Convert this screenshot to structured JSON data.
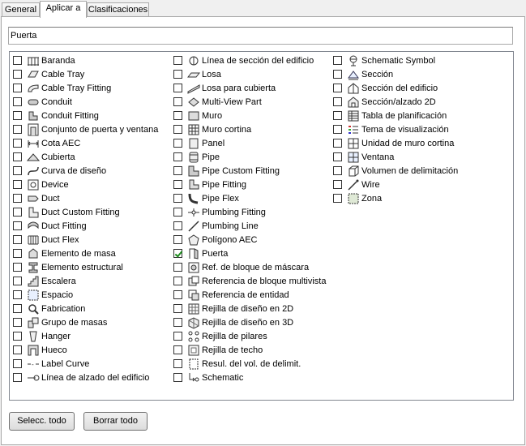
{
  "tabs": [
    {
      "label": "General"
    },
    {
      "label": "Aplicar a"
    },
    {
      "label": "Clasificaciones"
    }
  ],
  "name_field": {
    "value": "Puerta"
  },
  "columns": [
    [
      {
        "label": "Baranda",
        "icon": "railing-icon",
        "checked": false
      },
      {
        "label": "Cable Tray",
        "icon": "cable-tray-icon",
        "checked": false
      },
      {
        "label": "Cable Tray Fitting",
        "icon": "cable-tray-fitting-icon",
        "checked": false
      },
      {
        "label": "Conduit",
        "icon": "conduit-icon",
        "checked": false
      },
      {
        "label": "Conduit Fitting",
        "icon": "conduit-fitting-icon",
        "checked": false
      },
      {
        "label": "Conjunto de puerta y ventana",
        "icon": "door-window-assembly-icon",
        "checked": false
      },
      {
        "label": "Cota AEC",
        "icon": "dimension-icon",
        "checked": false
      },
      {
        "label": "Cubierta",
        "icon": "roof-icon",
        "checked": false
      },
      {
        "label": "Curva de diseño",
        "icon": "layout-curve-icon",
        "checked": false
      },
      {
        "label": "Device",
        "icon": "device-icon",
        "checked": false
      },
      {
        "label": "Duct",
        "icon": "duct-icon",
        "checked": false
      },
      {
        "label": "Duct Custom Fitting",
        "icon": "duct-custom-fitting-icon",
        "checked": false
      },
      {
        "label": "Duct Fitting",
        "icon": "duct-fitting-icon",
        "checked": false
      },
      {
        "label": "Duct Flex",
        "icon": "duct-flex-icon",
        "checked": false
      },
      {
        "label": "Elemento de masa",
        "icon": "mass-element-icon",
        "checked": false
      },
      {
        "label": "Elemento estructural",
        "icon": "structural-member-icon",
        "checked": false
      },
      {
        "label": "Escalera",
        "icon": "stair-icon",
        "checked": false
      },
      {
        "label": "Espacio",
        "icon": "space-icon",
        "checked": false
      },
      {
        "label": "Fabrication",
        "icon": "fabrication-icon",
        "checked": false
      },
      {
        "label": "Grupo de masas",
        "icon": "mass-group-icon",
        "checked": false
      },
      {
        "label": "Hanger",
        "icon": "hanger-icon",
        "checked": false
      },
      {
        "label": "Hueco",
        "icon": "opening-icon",
        "checked": false
      },
      {
        "label": "Label Curve",
        "icon": "label-curve-icon",
        "checked": false
      },
      {
        "label": "Línea de alzado del edificio",
        "icon": "elevation-line-icon",
        "checked": false
      }
    ],
    [
      {
        "label": "Línea de sección del edificio",
        "icon": "section-line-icon",
        "checked": false
      },
      {
        "label": "Losa",
        "icon": "slab-icon",
        "checked": false
      },
      {
        "label": "Losa para cubierta",
        "icon": "roof-slab-icon",
        "checked": false
      },
      {
        "label": "Multi-View Part",
        "icon": "multi-view-part-icon",
        "checked": false
      },
      {
        "label": "Muro",
        "icon": "wall-icon",
        "checked": false
      },
      {
        "label": "Muro cortina",
        "icon": "curtain-wall-icon",
        "checked": false
      },
      {
        "label": "Panel",
        "icon": "panel-icon",
        "checked": false
      },
      {
        "label": "Pipe",
        "icon": "pipe-icon",
        "checked": false
      },
      {
        "label": "Pipe Custom Fitting",
        "icon": "pipe-custom-fitting-icon",
        "checked": false
      },
      {
        "label": "Pipe Fitting",
        "icon": "pipe-fitting-icon",
        "checked": false
      },
      {
        "label": "Pipe Flex",
        "icon": "pipe-flex-icon",
        "checked": false
      },
      {
        "label": "Plumbing Fitting",
        "icon": "plumbing-fitting-icon",
        "checked": false
      },
      {
        "label": "Plumbing Line",
        "icon": "plumbing-line-icon",
        "checked": false
      },
      {
        "label": "Polígono AEC",
        "icon": "polygon-icon",
        "checked": false
      },
      {
        "label": "Puerta",
        "icon": "door-icon",
        "checked": true
      },
      {
        "label": "Ref. de bloque de máscara",
        "icon": "mask-block-ref-icon",
        "checked": false
      },
      {
        "label": "Referencia de bloque multivista",
        "icon": "multi-view-block-ref-icon",
        "checked": false
      },
      {
        "label": "Referencia de entidad",
        "icon": "entity-ref-icon",
        "checked": false
      },
      {
        "label": "Rejilla de diseño en 2D",
        "icon": "layout-grid-2d-icon",
        "checked": false
      },
      {
        "label": "Rejilla de diseño en 3D",
        "icon": "layout-grid-3d-icon",
        "checked": false
      },
      {
        "label": "Rejilla de pilares",
        "icon": "column-grid-icon",
        "checked": false
      },
      {
        "label": "Rejilla de techo",
        "icon": "ceiling-grid-icon",
        "checked": false
      },
      {
        "label": "Resul. del vol. de delimit.",
        "icon": "bounding-volume-result-icon",
        "checked": false
      },
      {
        "label": "Schematic",
        "icon": "schematic-icon",
        "checked": false
      }
    ],
    [
      {
        "label": "Schematic Symbol",
        "icon": "schematic-symbol-icon",
        "checked": false
      },
      {
        "label": "Sección",
        "icon": "section-icon",
        "checked": false
      },
      {
        "label": "Sección del edificio",
        "icon": "building-section-icon",
        "checked": false
      },
      {
        "label": "Sección/alzado 2D",
        "icon": "section-elevation-2d-icon",
        "checked": false
      },
      {
        "label": "Tabla de planificación",
        "icon": "schedule-table-icon",
        "checked": false
      },
      {
        "label": "Tema de visualización",
        "icon": "display-theme-icon",
        "checked": false
      },
      {
        "label": "Unidad de muro cortina",
        "icon": "curtain-wall-unit-icon",
        "checked": false
      },
      {
        "label": "Ventana",
        "icon": "window-icon",
        "checked": false
      },
      {
        "label": "Volumen de delimitación",
        "icon": "bounding-volume-icon",
        "checked": false
      },
      {
        "label": "Wire",
        "icon": "wire-icon",
        "checked": false
      },
      {
        "label": "Zona",
        "icon": "zone-icon",
        "checked": false
      }
    ]
  ],
  "buttons": {
    "select_all": "Selecc. todo",
    "clear_all": "Borrar todo"
  }
}
